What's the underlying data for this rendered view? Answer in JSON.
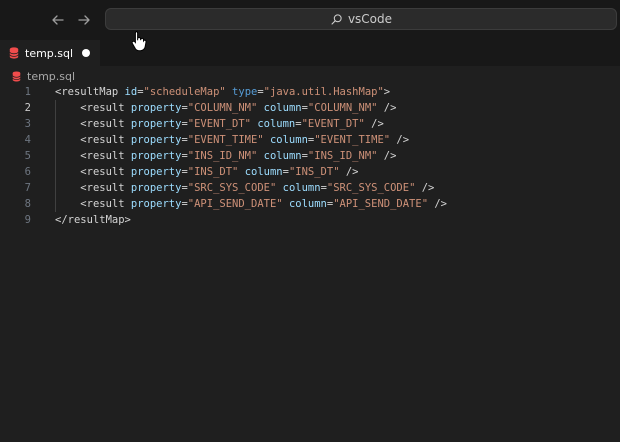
{
  "titlebar": {
    "back_icon": "arrow-left-icon",
    "forward_icon": "arrow-right-icon",
    "search": {
      "icon": "search-icon",
      "text": "vsCode"
    }
  },
  "tab": {
    "icon": "database-icon",
    "label": "temp.sql",
    "dirty": true,
    "icon_color": "#f14c4c"
  },
  "breadcrumb": {
    "icon": "database-icon",
    "label": "temp.sql"
  },
  "editor": {
    "active_line": 2,
    "lines": [
      {
        "n": "1",
        "indent": "",
        "parts": [
          {
            "t": "<resultMap ",
            "c": "tag"
          },
          {
            "t": "id",
            "c": "attr"
          },
          {
            "t": "=",
            "c": "punc"
          },
          {
            "t": "\"scheduleMap\"",
            "c": "str"
          },
          {
            "t": " ",
            "c": "punc"
          },
          {
            "t": "type",
            "c": "kw"
          },
          {
            "t": "=",
            "c": "punc"
          },
          {
            "t": "\"java.util.HashMap\"",
            "c": "str"
          },
          {
            "t": ">",
            "c": "tag"
          }
        ]
      },
      {
        "n": "2",
        "indent": "    ",
        "parts": [
          {
            "t": "<result ",
            "c": "tag"
          },
          {
            "t": "property",
            "c": "attr"
          },
          {
            "t": "=",
            "c": "punc"
          },
          {
            "t": "\"COLUMN_NM\"",
            "c": "str"
          },
          {
            "t": " ",
            "c": "punc"
          },
          {
            "t": "column",
            "c": "attr"
          },
          {
            "t": "=",
            "c": "punc"
          },
          {
            "t": "\"COLUMN_NM\"",
            "c": "str"
          },
          {
            "t": " />",
            "c": "tag"
          }
        ]
      },
      {
        "n": "3",
        "indent": "    ",
        "parts": [
          {
            "t": "<result ",
            "c": "tag"
          },
          {
            "t": "property",
            "c": "attr"
          },
          {
            "t": "=",
            "c": "punc"
          },
          {
            "t": "\"EVENT_DT\"",
            "c": "str"
          },
          {
            "t": " ",
            "c": "punc"
          },
          {
            "t": "column",
            "c": "attr"
          },
          {
            "t": "=",
            "c": "punc"
          },
          {
            "t": "\"EVENT_DT\"",
            "c": "str"
          },
          {
            "t": " />",
            "c": "tag"
          }
        ]
      },
      {
        "n": "4",
        "indent": "    ",
        "parts": [
          {
            "t": "<result ",
            "c": "tag"
          },
          {
            "t": "property",
            "c": "attr"
          },
          {
            "t": "=",
            "c": "punc"
          },
          {
            "t": "\"EVENT_TIME\"",
            "c": "str"
          },
          {
            "t": " ",
            "c": "punc"
          },
          {
            "t": "column",
            "c": "attr"
          },
          {
            "t": "=",
            "c": "punc"
          },
          {
            "t": "\"EVENT_TIME\"",
            "c": "str"
          },
          {
            "t": " />",
            "c": "tag"
          }
        ]
      },
      {
        "n": "5",
        "indent": "    ",
        "parts": [
          {
            "t": "<result ",
            "c": "tag"
          },
          {
            "t": "property",
            "c": "attr"
          },
          {
            "t": "=",
            "c": "punc"
          },
          {
            "t": "\"INS_ID_NM\"",
            "c": "str"
          },
          {
            "t": " ",
            "c": "punc"
          },
          {
            "t": "column",
            "c": "attr"
          },
          {
            "t": "=",
            "c": "punc"
          },
          {
            "t": "\"INS_ID_NM\"",
            "c": "str"
          },
          {
            "t": " />",
            "c": "tag"
          }
        ]
      },
      {
        "n": "6",
        "indent": "    ",
        "parts": [
          {
            "t": "<result ",
            "c": "tag"
          },
          {
            "t": "property",
            "c": "attr"
          },
          {
            "t": "=",
            "c": "punc"
          },
          {
            "t": "\"INS_DT\"",
            "c": "str"
          },
          {
            "t": " ",
            "c": "punc"
          },
          {
            "t": "column",
            "c": "attr"
          },
          {
            "t": "=",
            "c": "punc"
          },
          {
            "t": "\"INS_DT\"",
            "c": "str"
          },
          {
            "t": " />",
            "c": "tag"
          }
        ]
      },
      {
        "n": "7",
        "indent": "    ",
        "parts": [
          {
            "t": "<result ",
            "c": "tag"
          },
          {
            "t": "property",
            "c": "attr"
          },
          {
            "t": "=",
            "c": "punc"
          },
          {
            "t": "\"SRC_SYS_CODE\"",
            "c": "str"
          },
          {
            "t": " ",
            "c": "punc"
          },
          {
            "t": "column",
            "c": "attr"
          },
          {
            "t": "=",
            "c": "punc"
          },
          {
            "t": "\"SRC_SYS_CODE\"",
            "c": "str"
          },
          {
            "t": " />",
            "c": "tag"
          }
        ]
      },
      {
        "n": "8",
        "indent": "    ",
        "parts": [
          {
            "t": "<result ",
            "c": "tag"
          },
          {
            "t": "property",
            "c": "attr"
          },
          {
            "t": "=",
            "c": "punc"
          },
          {
            "t": "\"API_SEND_DATE\"",
            "c": "str"
          },
          {
            "t": " ",
            "c": "punc"
          },
          {
            "t": "column",
            "c": "attr"
          },
          {
            "t": "=",
            "c": "punc"
          },
          {
            "t": "\"API_SEND_DATE\"",
            "c": "str"
          },
          {
            "t": " />",
            "c": "tag"
          }
        ]
      },
      {
        "n": "9",
        "indent": "",
        "parts": [
          {
            "t": "</resultMap>",
            "c": "tag"
          }
        ]
      }
    ]
  }
}
